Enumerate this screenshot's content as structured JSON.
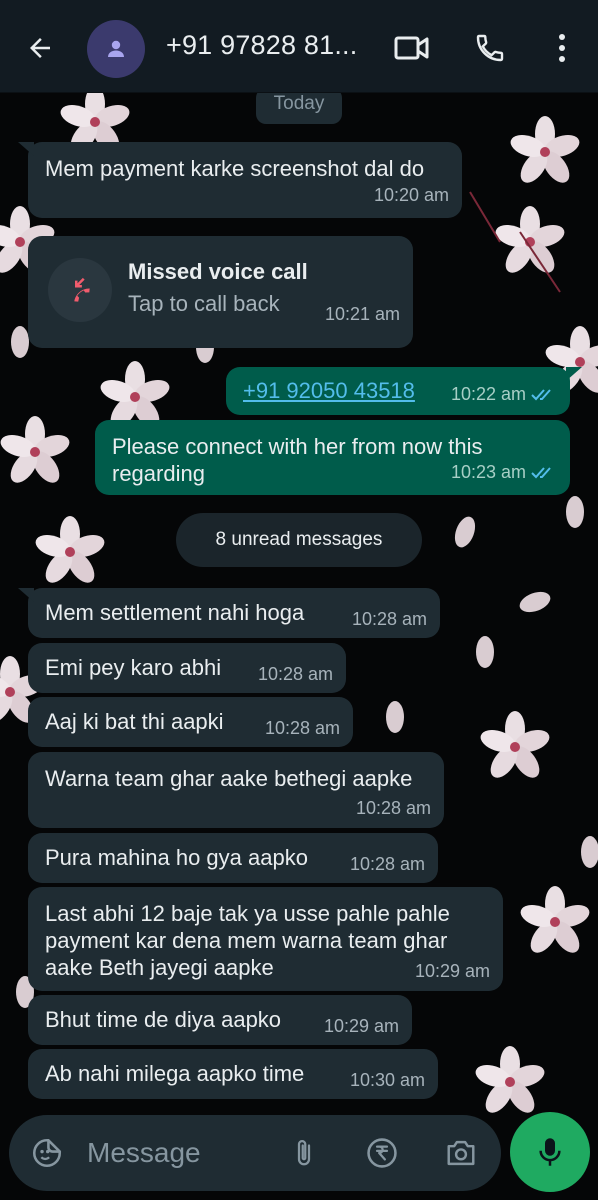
{
  "header": {
    "contact_name": "+91 97828 81...",
    "back_icon": "arrow-left-icon",
    "avatar_icon": "person-icon",
    "video_icon": "video-call-icon",
    "call_icon": "phone-icon",
    "menu_icon": "more-vert-icon"
  },
  "chat": {
    "day_label": "Today",
    "messages": [
      {
        "dir": "in",
        "text": "Mem payment karke screenshot dal do",
        "time": "10:20 am"
      },
      {
        "dir": "in",
        "type": "missed_call",
        "title": "Missed voice call",
        "subtitle": "Tap to call back",
        "time": "10:21 am"
      },
      {
        "dir": "out",
        "text": "+91 92050 43518",
        "time": "10:22 am",
        "status": "read"
      },
      {
        "dir": "out",
        "text": "Please connect with her from now this\nregarding",
        "time": "10:23 am",
        "status": "read"
      },
      {
        "dir": "in",
        "text": "Mem settlement nahi hoga",
        "time": "10:28 am"
      },
      {
        "dir": "in",
        "text": "Emi pey karo abhi",
        "time": "10:28 am"
      },
      {
        "dir": "in",
        "text": "Aaj ki bat thi aapki",
        "time": "10:28 am"
      },
      {
        "dir": "in",
        "text": "Warna team ghar aake bethegi aapke",
        "time": "10:28 am"
      },
      {
        "dir": "in",
        "text": "Pura mahina ho gya aapko",
        "time": "10:28 am"
      },
      {
        "dir": "in",
        "text": "Last abhi 12 baje tak ya usse pahle pahle\npayment kar dena mem warna team ghar\naake Beth jayegi aapke",
        "time": "10:29 am"
      },
      {
        "dir": "in",
        "text": "Bhut time de diya aapko",
        "time": "10:29 am"
      },
      {
        "dir": "in",
        "text": "Ab nahi milega aapko time",
        "time": "10:30 am"
      }
    ],
    "unread_label": "8 unread messages"
  },
  "composer": {
    "placeholder": "Message",
    "icons": [
      "sticker-icon",
      "attach-icon",
      "rupee-payment-icon",
      "camera-icon",
      "mic-icon"
    ]
  },
  "colors": {
    "header_bg": "#121b22",
    "incoming_bubble": "#1f2c33",
    "outgoing_bubble": "#005c4b",
    "link": "#53bdeb",
    "mic_button": "#1faa61",
    "missed_call_red": "#f15c6d"
  }
}
